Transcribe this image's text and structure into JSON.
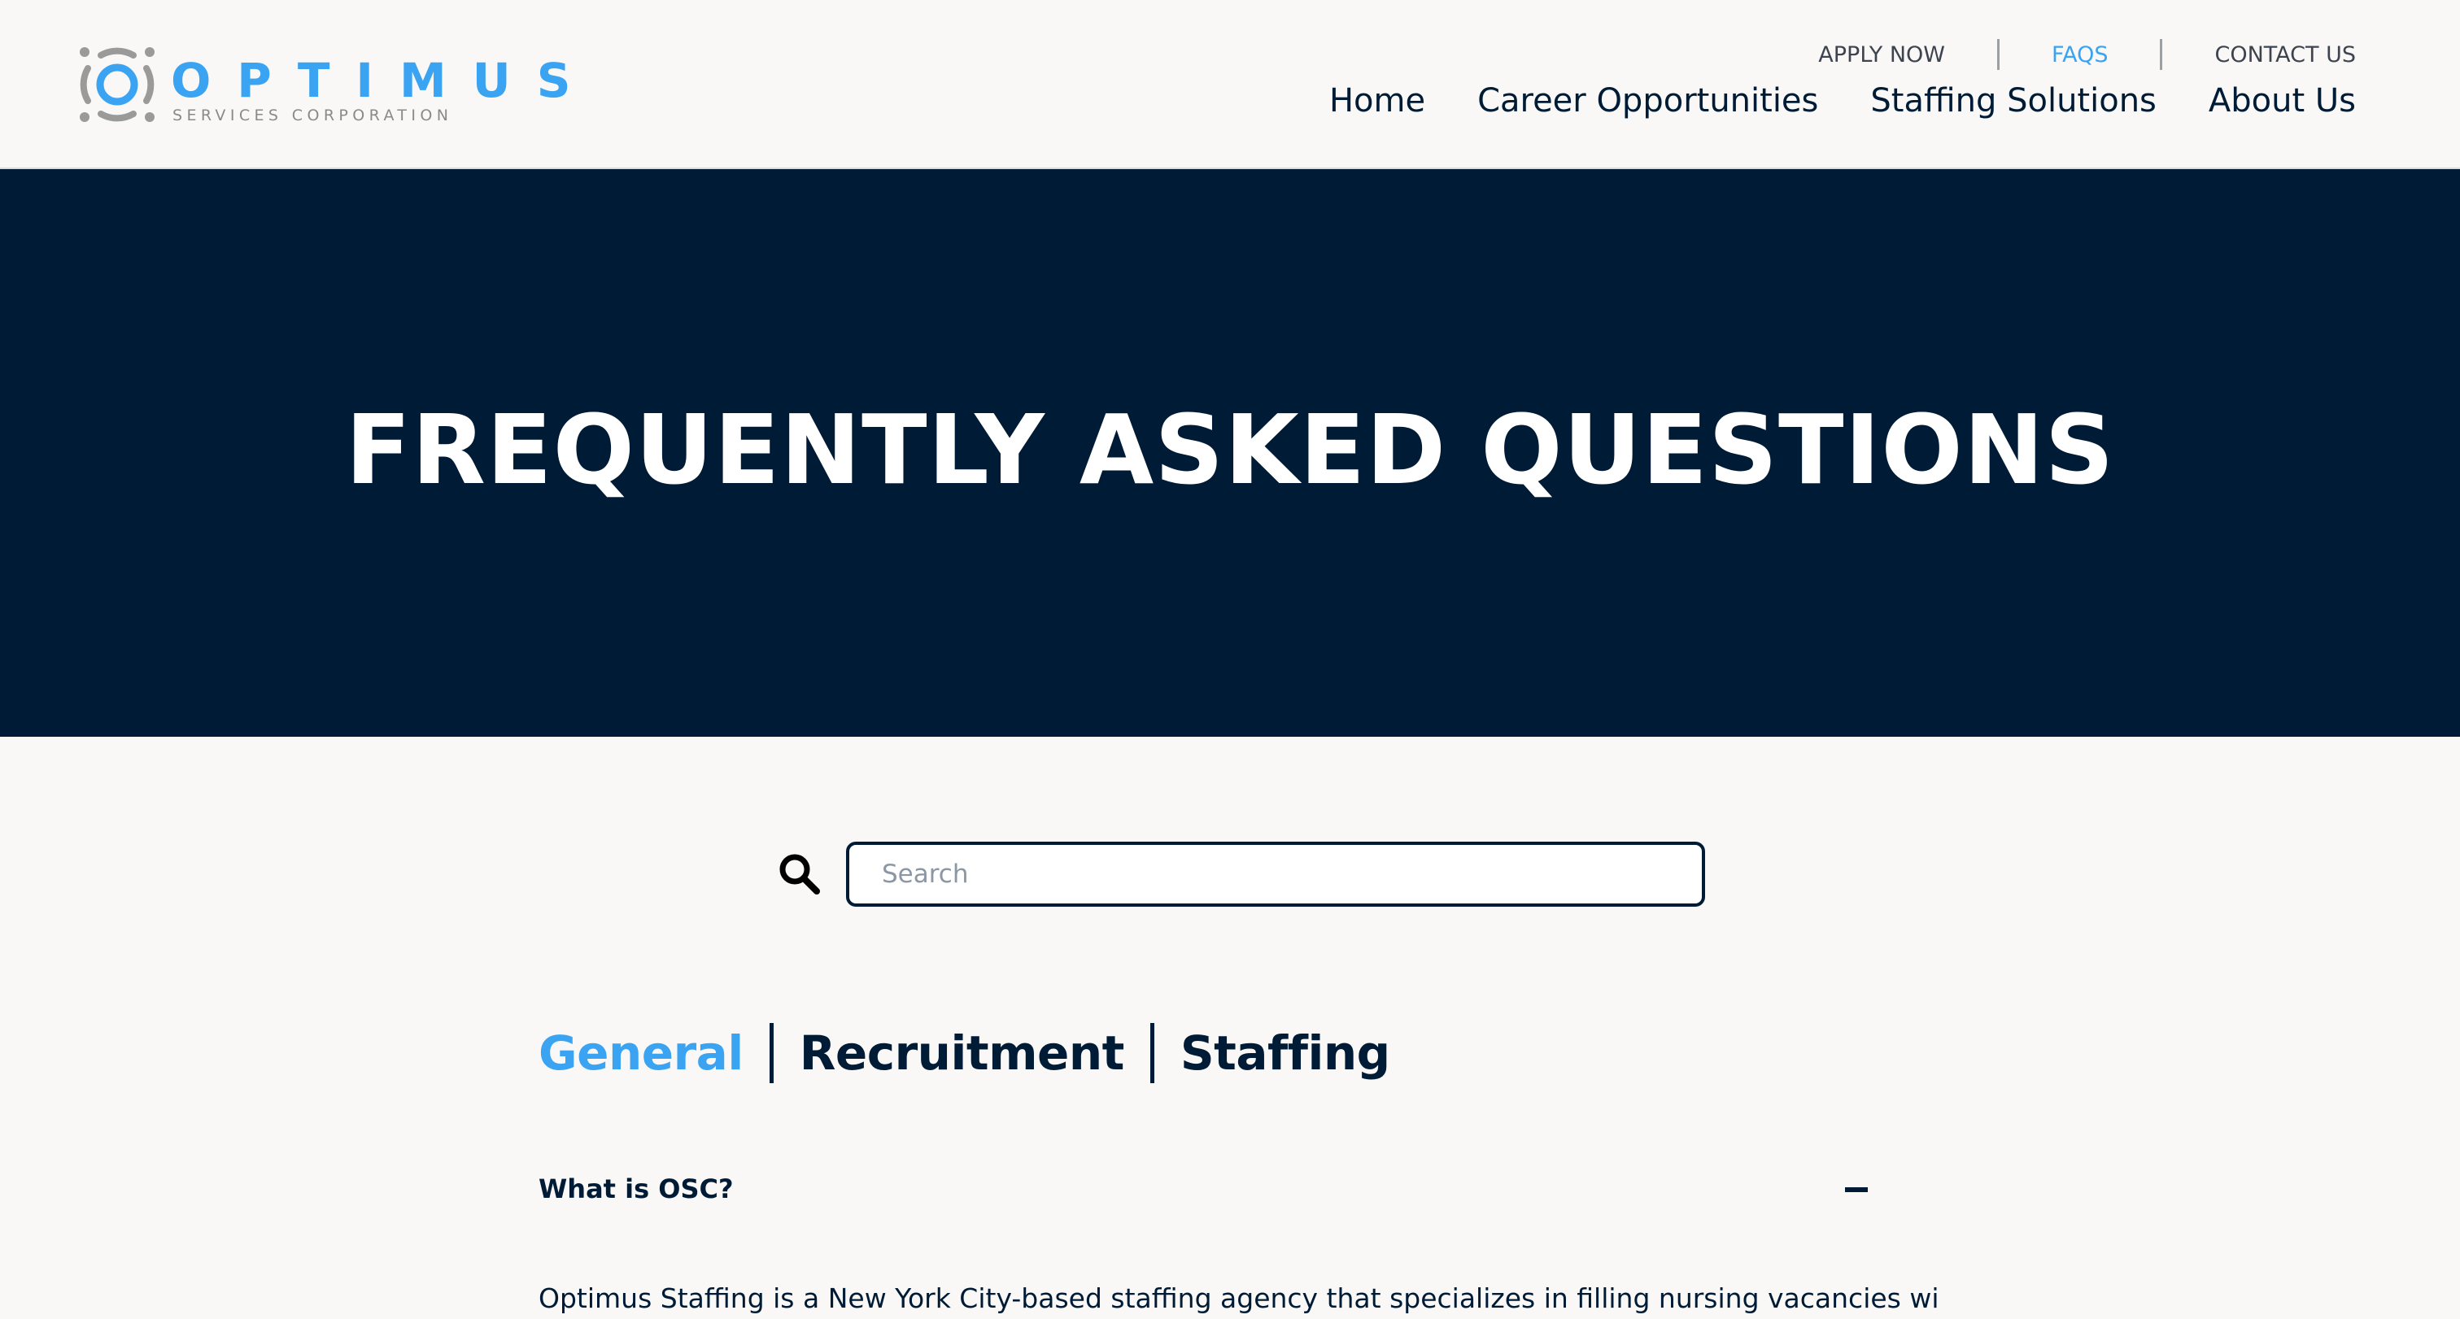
{
  "brand": {
    "name": "OPTIMUS",
    "tagline": "SERVICES CORPORATION",
    "accent_color": "#3aa3f2",
    "logo_gray": "#9a9a9a"
  },
  "utility_nav": [
    {
      "label": "APPLY NOW",
      "active": false
    },
    {
      "label": "FAQS",
      "active": true
    },
    {
      "label": "CONTACT US",
      "active": false
    }
  ],
  "main_nav": [
    {
      "label": "Home"
    },
    {
      "label": "Career Opportunities"
    },
    {
      "label": "Staffing Solutions"
    },
    {
      "label": "About Us"
    }
  ],
  "hero": {
    "title": "FREQUENTLY ASKED QUESTIONS",
    "background_color": "#001b35"
  },
  "search": {
    "placeholder": "Search",
    "value": "",
    "icon": "search-icon"
  },
  "tabs": [
    {
      "label": "General",
      "active": true
    },
    {
      "label": "Recruitment",
      "active": false
    },
    {
      "label": "Staffing",
      "active": false
    }
  ],
  "faq": {
    "items": [
      {
        "question": "What is OSC?",
        "expanded": true,
        "toggle_icon": "minus-icon",
        "answer_visible": "Optimus Staffing is a New York City-based staffing agency that specializes in filling nursing vacancies with"
      }
    ]
  }
}
